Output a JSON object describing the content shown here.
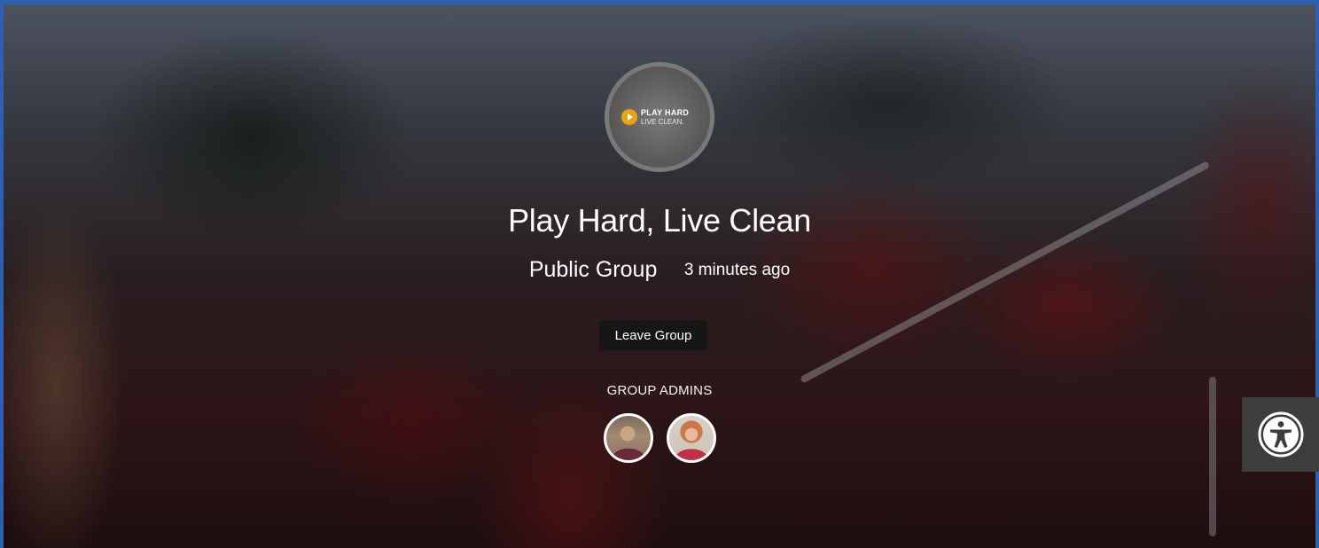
{
  "group": {
    "logo_line1": "PLAY HARD",
    "logo_line2": "LIVE CLEAN.",
    "title": "Play Hard, Live Clean",
    "type": "Public Group",
    "last_active": "3 minutes ago"
  },
  "actions": {
    "leave_label": "Leave Group"
  },
  "admins": {
    "heading": "GROUP ADMINS"
  },
  "accessibility": {
    "icon": "accessibility-icon"
  },
  "colors": {
    "frame_border": "#2f5fb3",
    "button_bg": "#161616",
    "logo_accent": "#e8a317",
    "a11y_bg": "#3d3d3d"
  }
}
